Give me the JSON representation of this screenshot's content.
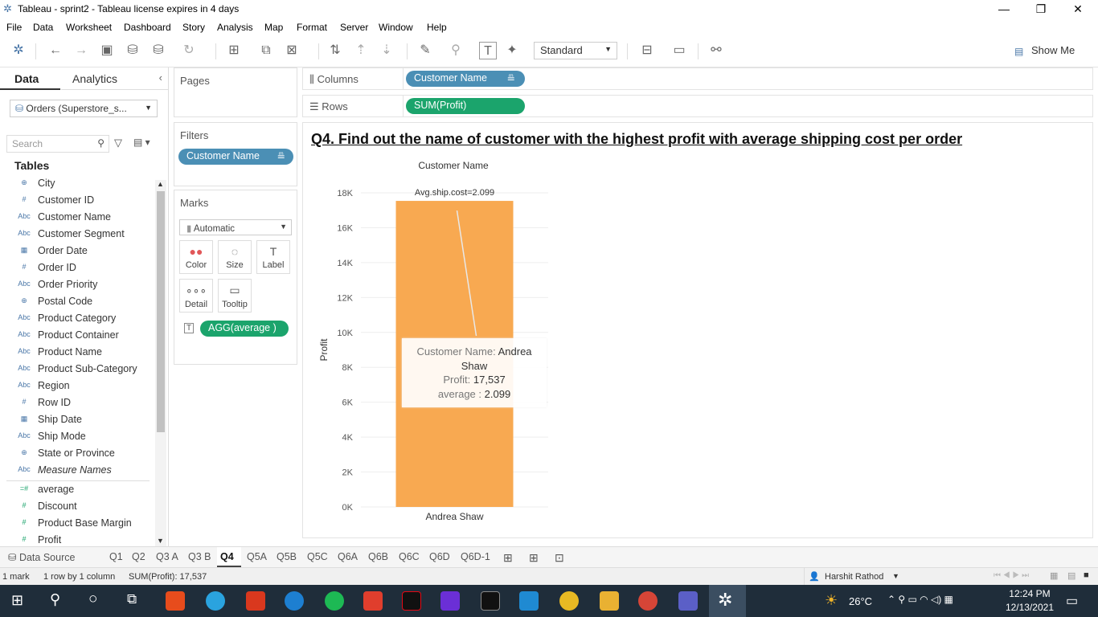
{
  "window": {
    "title": "Tableau - sprint2 - Tableau license expires in 4 days"
  },
  "menu": [
    "File",
    "Data",
    "Worksheet",
    "Dashboard",
    "Story",
    "Analysis",
    "Map",
    "Format",
    "Server",
    "Window",
    "Help"
  ],
  "toolbar": {
    "view_mode": "Standard",
    "show_me": "Show Me"
  },
  "left_pane": {
    "tab_data": "Data",
    "tab_analytics": "Analytics",
    "datasource": "Orders (Superstore_s...",
    "search_placeholder": "Search",
    "tables_heading": "Tables",
    "fields": [
      {
        "icon": "⊕",
        "name": "City"
      },
      {
        "icon": "#",
        "name": "Customer ID"
      },
      {
        "icon": "Abc",
        "name": "Customer Name"
      },
      {
        "icon": "Abc",
        "name": "Customer Segment"
      },
      {
        "icon": "▦",
        "name": "Order Date"
      },
      {
        "icon": "#",
        "name": "Order ID"
      },
      {
        "icon": "Abc",
        "name": "Order Priority"
      },
      {
        "icon": "⊕",
        "name": "Postal Code"
      },
      {
        "icon": "Abc",
        "name": "Product Category"
      },
      {
        "icon": "Abc",
        "name": "Product Container"
      },
      {
        "icon": "Abc",
        "name": "Product Name"
      },
      {
        "icon": "Abc",
        "name": "Product Sub-Category"
      },
      {
        "icon": "Abc",
        "name": "Region"
      },
      {
        "icon": "#",
        "name": "Row ID"
      },
      {
        "icon": "▦",
        "name": "Ship Date"
      },
      {
        "icon": "Abc",
        "name": "Ship Mode"
      },
      {
        "icon": "⊕",
        "name": "State or Province"
      },
      {
        "icon": "Abc",
        "name": "Measure Names"
      }
    ],
    "measures": [
      {
        "icon": "=#",
        "name": "average"
      },
      {
        "icon": "#",
        "name": "Discount"
      },
      {
        "icon": "#",
        "name": "Product Base Margin"
      },
      {
        "icon": "#",
        "name": "Profit"
      }
    ]
  },
  "cards": {
    "pages": "Pages",
    "filters": "Filters",
    "filter_pill": "Customer Name",
    "marks": "Marks",
    "mark_type": "Automatic",
    "mark_buttons": [
      {
        "icon": "●●",
        "label": "Color"
      },
      {
        "icon": "◌",
        "label": "Size"
      },
      {
        "icon": "T",
        "label": "Label"
      },
      {
        "icon": "∘∘∘",
        "label": "Detail"
      },
      {
        "icon": "▭",
        "label": "Tooltip"
      }
    ],
    "marks_pill": "AGG(average )"
  },
  "shelves": {
    "columns_label": "Columns",
    "columns_pill": "Customer Name",
    "rows_label": "Rows",
    "rows_pill": "SUM(Profit)"
  },
  "sheet": {
    "title": "Q4. Find out the name of customer with the highest profit with average shipping cost per order ",
    "header": "Customer Name",
    "y_title": "Profit",
    "bar_label": "Avg.ship.cost=2.099",
    "tooltip": {
      "k1": "Customer Name:",
      "v1a": "Andrea",
      "v1b": "Shaw",
      "k2": "Profit:",
      "v2": "17,537",
      "k3": "average :",
      "v3": "2.099"
    }
  },
  "chart_data": {
    "type": "bar",
    "categories": [
      "Andrea Shaw"
    ],
    "values": [
      17537
    ],
    "ylabel": "Profit",
    "yticks": [
      "0K",
      "2K",
      "4K",
      "6K",
      "8K",
      "10K",
      "12K",
      "14K",
      "16K",
      "18K"
    ],
    "ylim": [
      0,
      18000
    ],
    "bar_color": "#f8a951"
  },
  "sheet_tabs": [
    "Data Source",
    "Q1",
    "Q2",
    "Q3 A",
    "Q3 B",
    "Q4",
    "Q5A",
    "Q5B",
    "Q5C",
    "Q6A",
    "Q6B",
    "Q6C",
    "Q6D",
    "Q6D-1"
  ],
  "active_tab": "Q4",
  "status": {
    "marks": "1 mark",
    "rows": "1 row by 1 column",
    "sum": "SUM(Profit): 17,537",
    "user": "Harshit Rathod"
  },
  "taskbar": {
    "temp": "26°C",
    "time": "12:24 PM",
    "date": "12/13/2021"
  }
}
